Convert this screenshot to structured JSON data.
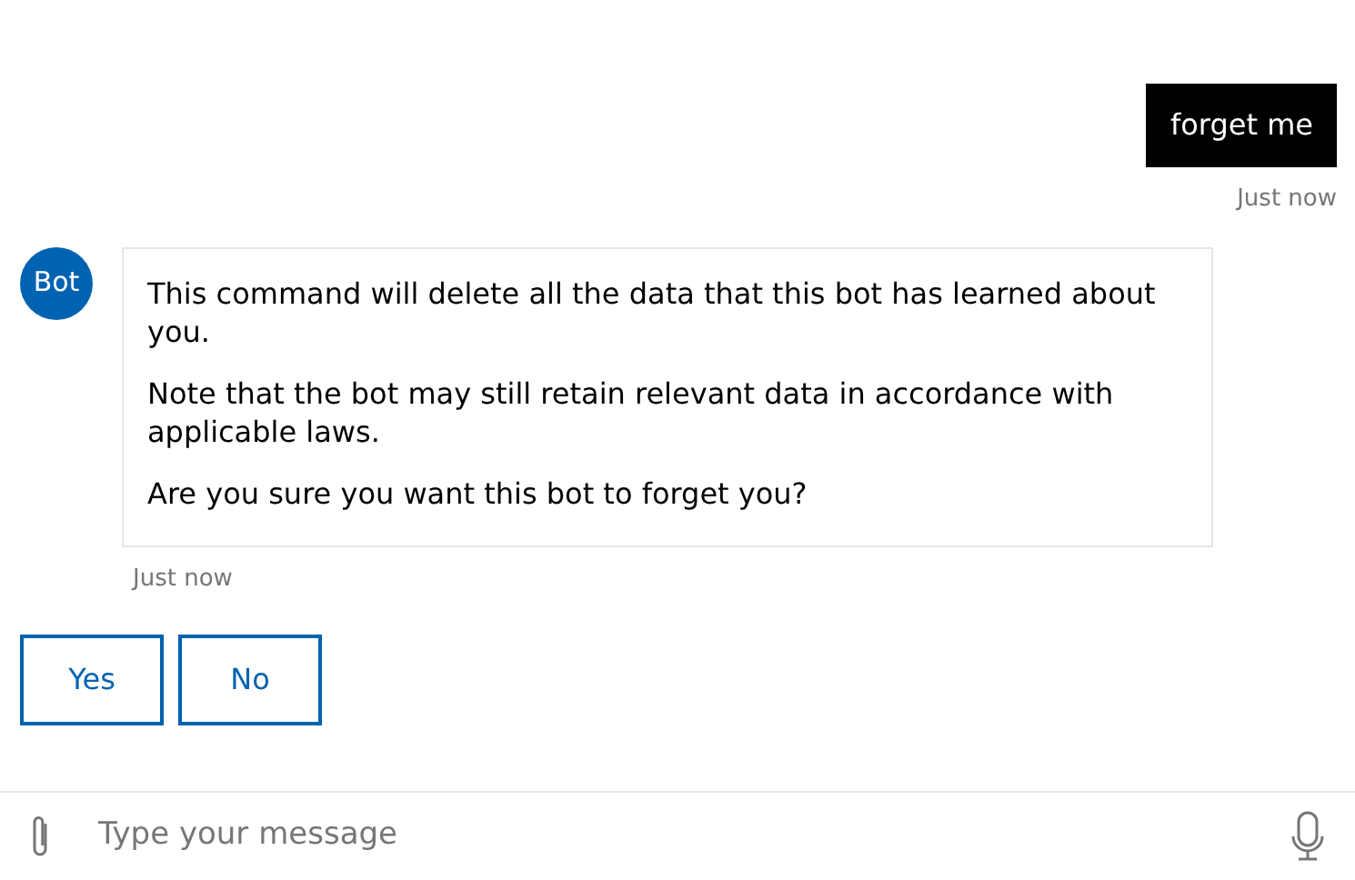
{
  "messages": [
    {
      "kind": "outgoing",
      "paragraphs": [
        "forget me"
      ],
      "time": "Just now"
    },
    {
      "kind": "incoming",
      "avatar": "Bot",
      "paragraphs": [
        "This command will delete all the data that this bot has learned about you.",
        "Note that the bot may still retain relevant data in accordance with applicable laws.",
        "Are you sure you want this bot to forget you?"
      ],
      "time": "Just now"
    }
  ],
  "actions": [
    "Yes",
    "No"
  ],
  "composer": {
    "placeholder": "Type your message"
  }
}
